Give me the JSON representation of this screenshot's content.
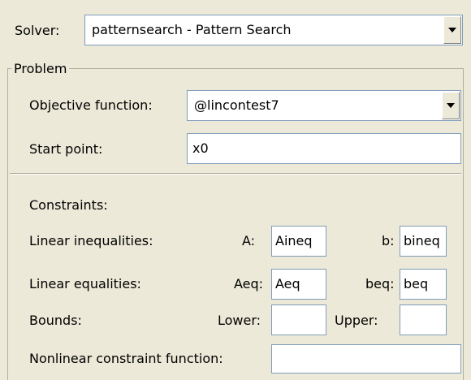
{
  "solver": {
    "label": "Solver:",
    "value": "patternsearch - Pattern Search"
  },
  "problem": {
    "legend": "Problem",
    "objective_label": "Objective function:",
    "objective_value": "@lincontest7",
    "start_label": "Start point:",
    "start_value": "x0"
  },
  "constraints": {
    "heading": "Constraints:",
    "linear_ineq": {
      "label": "Linear inequalities:",
      "a_label": "A:",
      "a_value": "Aineq",
      "b_label": "b:",
      "b_value": "bineq"
    },
    "linear_eq": {
      "label": "Linear equalities:",
      "aeq_label": "Aeq:",
      "aeq_value": "Aeq",
      "beq_label": "beq:",
      "beq_value": "beq"
    },
    "bounds": {
      "label": "Bounds:",
      "lower_label": "Lower:",
      "lower_value": "",
      "upper_label": "Upper:",
      "upper_value": ""
    },
    "nonlinear": {
      "label": "Nonlinear constraint function:",
      "value": ""
    }
  },
  "icons": {
    "dropdown": "chevron-down-icon"
  }
}
